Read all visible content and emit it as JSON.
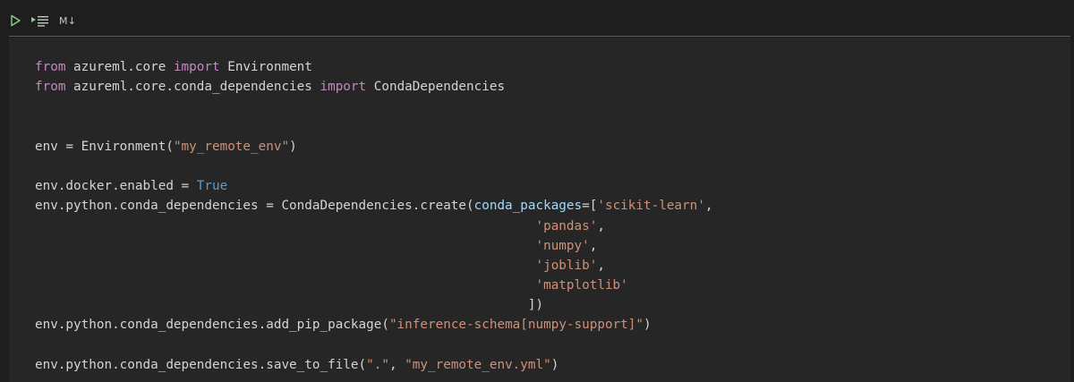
{
  "toolbar": {
    "run_icon": "play-triangle",
    "run_by_line_icon": "run-by-line",
    "cell_type_label": "M↓"
  },
  "colors": {
    "background": "#1e1e1e",
    "editor_background": "#262626",
    "keyword": "#c586c0",
    "string": "#ce9178",
    "constant": "#569cd6",
    "parameter": "#9cdcfe",
    "text": "#d4d4d4",
    "run_icon": "#89d185"
  },
  "code": {
    "lines": [
      [
        {
          "t": "kw",
          "v": "from"
        },
        {
          "t": "plain",
          "v": " azureml.core "
        },
        {
          "t": "kw",
          "v": "import"
        },
        {
          "t": "plain",
          "v": " Environment"
        }
      ],
      [
        {
          "t": "kw",
          "v": "from"
        },
        {
          "t": "plain",
          "v": " azureml.core.conda_dependencies "
        },
        {
          "t": "kw",
          "v": "import"
        },
        {
          "t": "plain",
          "v": " CondaDependencies"
        }
      ],
      [],
      [],
      [
        {
          "t": "plain",
          "v": "env = Environment("
        },
        {
          "t": "str",
          "v": "\"my_remote_env\""
        },
        {
          "t": "plain",
          "v": ")"
        }
      ],
      [],
      [
        {
          "t": "plain",
          "v": "env.docker.enabled = "
        },
        {
          "t": "const",
          "v": "True"
        }
      ],
      [
        {
          "t": "plain",
          "v": "env.python.conda_dependencies = CondaDependencies.create("
        },
        {
          "t": "param",
          "v": "conda_packages"
        },
        {
          "t": "plain",
          "v": "=["
        },
        {
          "t": "str",
          "v": "'scikit-learn'"
        },
        {
          "t": "plain",
          "v": ","
        }
      ],
      [
        {
          "t": "plain",
          "v": "                                                                 "
        },
        {
          "t": "str",
          "v": "'pandas'"
        },
        {
          "t": "plain",
          "v": ","
        }
      ],
      [
        {
          "t": "plain",
          "v": "                                                                 "
        },
        {
          "t": "str",
          "v": "'numpy'"
        },
        {
          "t": "plain",
          "v": ","
        }
      ],
      [
        {
          "t": "plain",
          "v": "                                                                 "
        },
        {
          "t": "str",
          "v": "'joblib'"
        },
        {
          "t": "plain",
          "v": ","
        }
      ],
      [
        {
          "t": "plain",
          "v": "                                                                 "
        },
        {
          "t": "str",
          "v": "'matplotlib'"
        }
      ],
      [
        {
          "t": "plain",
          "v": "                                                                ])"
        }
      ],
      [
        {
          "t": "plain",
          "v": "env.python.conda_dependencies.add_pip_package("
        },
        {
          "t": "str",
          "v": "\"inference-schema[numpy-support]\""
        },
        {
          "t": "plain",
          "v": ")"
        }
      ],
      [],
      [
        {
          "t": "plain",
          "v": "env.python.conda_dependencies.save_to_file("
        },
        {
          "t": "str",
          "v": "\".\""
        },
        {
          "t": "plain",
          "v": ", "
        },
        {
          "t": "str",
          "v": "\"my_remote_env.yml\""
        },
        {
          "t": "plain",
          "v": ")"
        }
      ]
    ]
  }
}
